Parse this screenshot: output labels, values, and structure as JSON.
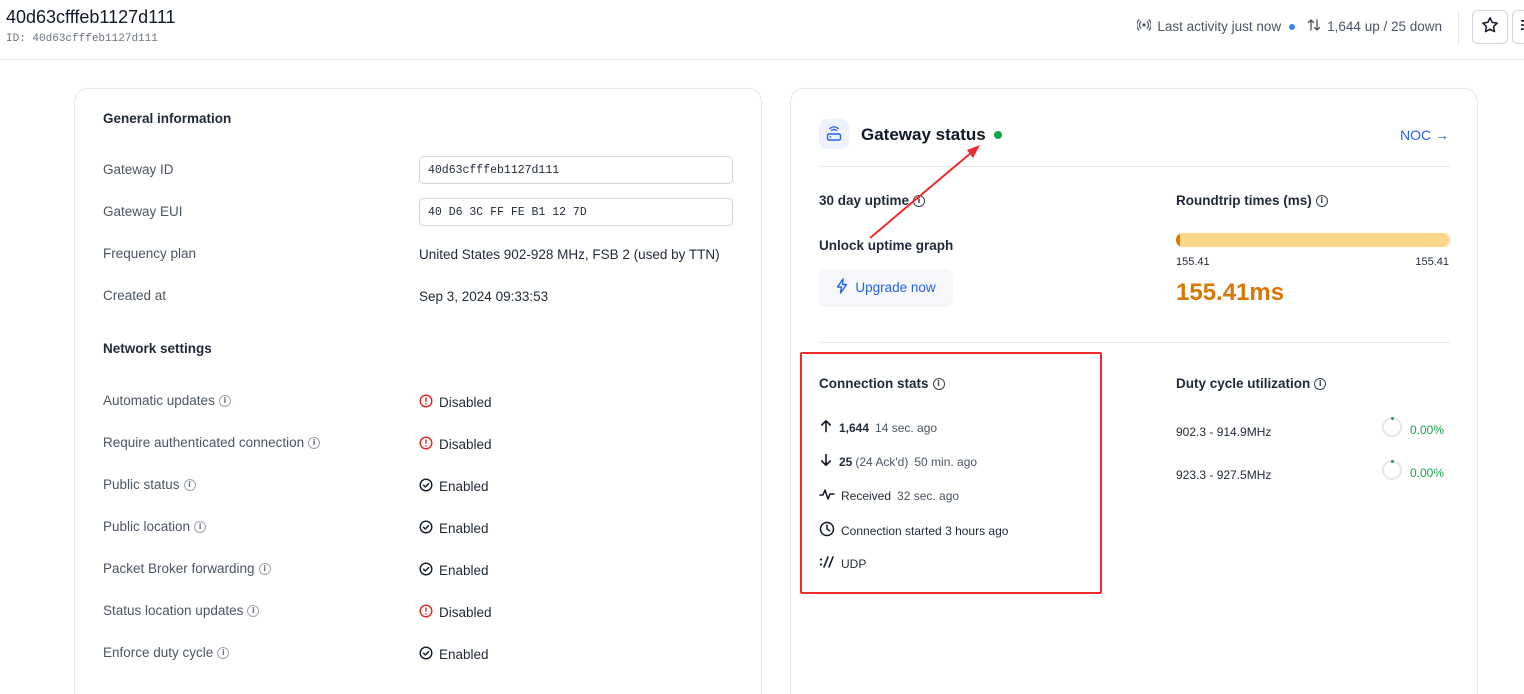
{
  "header": {
    "title": "40d63cfffeb1127d111",
    "id_label": "ID:",
    "id_value": "40d63cfffeb1127d111",
    "activity": "Last activity just now",
    "traffic": "1,644 up / 25 down"
  },
  "general": {
    "title": "General information",
    "rows": [
      {
        "label": "Gateway ID",
        "value": "40d63cfffeb1127d111"
      },
      {
        "label": "Gateway EUI",
        "value": "40 D6 3C FF FE B1 12 7D"
      },
      {
        "label": "Frequency plan",
        "value": "United States 902-928 MHz, FSB 2 (used by TTN)"
      },
      {
        "label": "Created at",
        "value": "Sep 3, 2024 09:33:53"
      }
    ]
  },
  "network": {
    "title": "Network settings",
    "rows": [
      {
        "label": "Automatic updates",
        "value": "Disabled"
      },
      {
        "label": "Require authenticated connection",
        "value": "Disabled"
      },
      {
        "label": "Public status",
        "value": "Enabled"
      },
      {
        "label": "Public location",
        "value": "Enabled"
      },
      {
        "label": "Packet Broker forwarding",
        "value": "Enabled"
      },
      {
        "label": "Status location updates",
        "value": "Disabled"
      },
      {
        "label": "Enforce duty cycle",
        "value": "Enabled"
      }
    ]
  },
  "status": {
    "title": "Gateway status",
    "noc_link": "NOC →",
    "uptime_title": "30 day uptime",
    "unlock_text": "Unlock uptime graph",
    "upgrade_label": "Upgrade now",
    "roundtrip_title": "Roundtrip times (ms)",
    "roundtrip_min": "155.41",
    "roundtrip_max": "155.41",
    "roundtrip_value": "155.41ms",
    "connection_title": "Connection stats",
    "up_count": "1,644",
    "up_time": "14 sec. ago",
    "down_count": "25",
    "down_ack": "(24 Ack'd)",
    "down_time": "50 min. ago",
    "received_label": "Received",
    "received_time": "32 sec. ago",
    "connection_started": "Connection started 3 hours ago",
    "protocol": "UDP",
    "duty_title": "Duty cycle utilization",
    "duty": [
      {
        "band": "902.3 - 914.9MHz",
        "value": "0.00%"
      },
      {
        "band": "923.3 - 927.5MHz",
        "value": "0.00%"
      }
    ]
  },
  "colors": {
    "accent": "#2563eb",
    "success": "#16a34a",
    "error": "#dc2626",
    "warning": "#d97706",
    "annotation": "#ef2b2b"
  }
}
